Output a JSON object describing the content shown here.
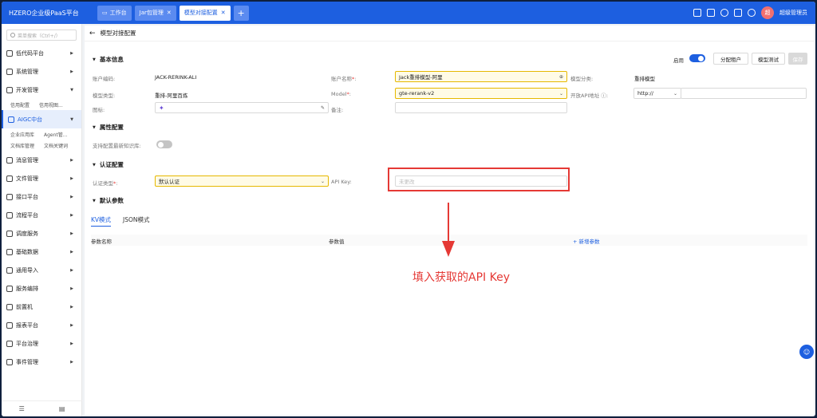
{
  "header": {
    "brand": "HZERO企业级PaaS平台",
    "tabs": [
      {
        "label": "工作台"
      },
      {
        "label": "Jar包管理"
      },
      {
        "label": "模型对接配置"
      }
    ],
    "user_avatar": "超",
    "user_name": "超级管理员"
  },
  "sidebar": {
    "search_placeholder": "菜单搜索（Ctrl+/）",
    "items": [
      {
        "label": "低代码平台"
      },
      {
        "label": "系统管理"
      },
      {
        "label": "开发管理"
      },
      {
        "label": "AIGC中台"
      },
      {
        "label": "消息管理"
      },
      {
        "label": "文件管理"
      },
      {
        "label": "接口平台"
      },
      {
        "label": "流程平台"
      },
      {
        "label": "调度服务"
      },
      {
        "label": "基础数据"
      },
      {
        "label": "通用导入"
      },
      {
        "label": "服务编排"
      },
      {
        "label": "前置机"
      },
      {
        "label": "报表平台"
      },
      {
        "label": "平台治理"
      },
      {
        "label": "事件管理"
      }
    ],
    "sub_dev": [
      "信用配置",
      "信用视图..."
    ],
    "sub_aigc_1": [
      "企业应用库",
      "Agent管..."
    ],
    "sub_aigc_2": [
      "文档库管理",
      "文档关键词"
    ]
  },
  "page": {
    "title": "模型对接配置",
    "sections": {
      "basic": "基本信息",
      "attr": "属性配置",
      "auth": "认证配置",
      "default_params": "默认参数"
    },
    "actions": {
      "enable_label": "启用",
      "enabled": true,
      "assign_tenant": "分配租户",
      "model_test": "模型测试",
      "save": "保存"
    },
    "basic": {
      "account_code_label": "账户编码:",
      "account_code": "JACK-RERINK-ALI",
      "account_name_label": "账户名称",
      "account_name": "Jack重排模型-阿里",
      "model_category_label": "模型分类:",
      "model_category": "重排模型",
      "model_type_label": "模型类型:",
      "model_type": "重排-阿里百炼",
      "model_label": "Model",
      "model": "gte-rerank-v2",
      "open_api_label": "开放API地址",
      "open_api_protocol": "http://",
      "icon_label": "图标:",
      "remark_label": "备注:"
    },
    "attr": {
      "support_label": "支持配置最新知识库:",
      "support_enabled": false
    },
    "auth": {
      "auth_type_label": "认证类型",
      "auth_type": "默认认证",
      "api_key_label": "API Key:",
      "api_key_placeholder": "未更改"
    },
    "params": {
      "tabs": [
        "KV模式",
        "JSON模式"
      ],
      "col_name": "参数名称",
      "col_value": "参数值",
      "add_label": "+ 新增参数"
    },
    "annotation": "填入获取的API Key"
  },
  "colors": {
    "primary": "#1d5fe0",
    "warn_bg": "#fffbe6",
    "annotation": "#e53935"
  }
}
